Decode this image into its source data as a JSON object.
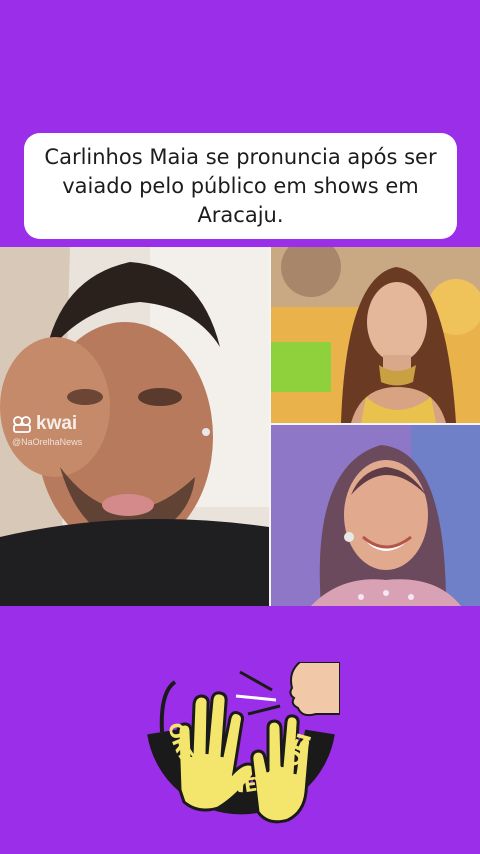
{
  "headline": "Carlinhos Maia se pronuncia após ser vaiado pelo público em shows em Aracaju.",
  "watermark": {
    "brand": "kwai",
    "handle": "@NaOrelhaNews"
  },
  "logo": {
    "text": "NA ORELHA NEWS OFICIAL"
  },
  "colors": {
    "background": "#9b2ee8",
    "headline_box": "#ffffff",
    "logo_ring": "#1a1a1a",
    "logo_fill": "#f4e66c"
  }
}
